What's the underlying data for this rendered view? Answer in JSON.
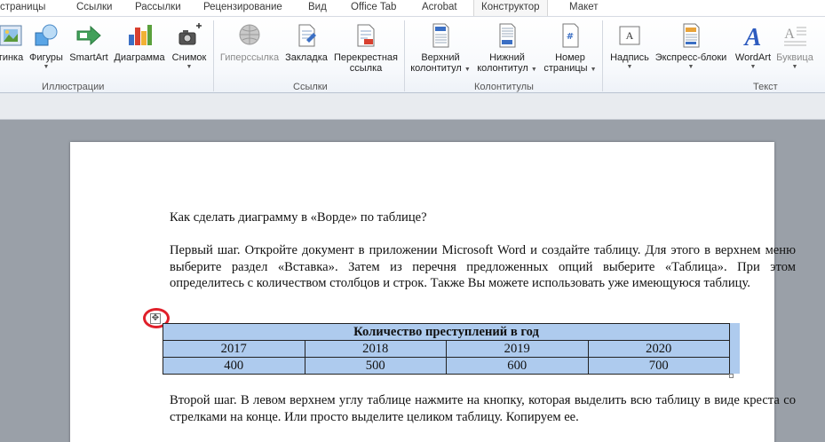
{
  "ribbon": {
    "tabs": [
      "страницы",
      "Ссылки",
      "Рассылки",
      "Рецензирование",
      "Вид",
      "Office Tab",
      "Acrobat",
      "Конструктор",
      "Макет"
    ],
    "groups": {
      "illustrations": {
        "label": "Иллюстрации",
        "buttons": {
          "picture": "тинка",
          "shapes": "Фигуры",
          "smartart": "SmartArt",
          "chart": "Диаграмма",
          "screenshot": "Снимок"
        }
      },
      "links": {
        "label": "Ссылки",
        "buttons": {
          "hyperlink": "Гиперссылка",
          "bookmark": "Закладка",
          "crossref_line1": "Перекрестная",
          "crossref_line2": "ссылка"
        }
      },
      "headers": {
        "label": "Колонтитулы",
        "buttons": {
          "header_line1": "Верхний",
          "header_line2": "колонтитул",
          "footer_line1": "Нижний",
          "footer_line2": "колонтитул",
          "pagenum_line1": "Номер",
          "pagenum_line2": "страницы"
        }
      },
      "text": {
        "label": "Текст",
        "buttons": {
          "textbox": "Надпись",
          "quickparts": "Экспресс-блоки",
          "wordart": "WordArt",
          "dropcap": "Буквица"
        }
      }
    }
  },
  "document": {
    "heading": "Как сделать диаграмму в «Ворде» по таблице?",
    "paragraph1": "Первый шаг. Откройте документ в приложении Microsoft Word и создайте таблицу. Для этого в верхнем меню выберите раздел «Вставка». Затем из перечня предложенных опций выберите «Таблица». При этом определитесь с количеством столбцов и строк. Также Вы можете использовать уже имеющуюся таблицу.",
    "table": {
      "title": "Количество преступлений в год",
      "years": [
        "2017",
        "2018",
        "2019",
        "2020"
      ],
      "values": [
        "400",
        "500",
        "600",
        "700"
      ]
    },
    "paragraph2": "Второй шаг. В левом верхнем углу таблице нажмите на кнопку, которая выделить всю таблицу в виде креста со стрелками на конце. Или просто выделите целиком таблицу. Копируем ее."
  },
  "icons": {
    "move_handle": "move-cross-icon"
  },
  "colors": {
    "selection": "#aecbee",
    "highlight_ring": "#e0202a",
    "text_accent": "#1e3a8a"
  }
}
